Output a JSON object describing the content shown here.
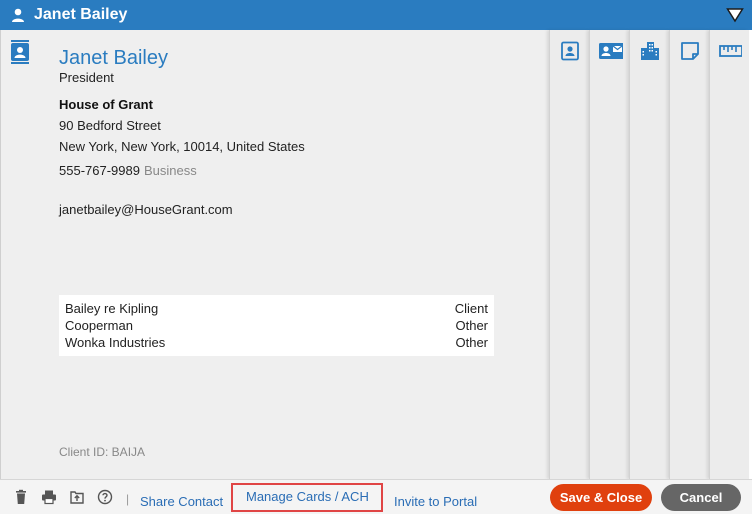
{
  "window": {
    "title": "Janet Bailey"
  },
  "contact": {
    "name": "Janet Bailey",
    "job_title": "President",
    "company": "House of Grant",
    "address_line1": "90 Bedford Street",
    "address_line2": "New York, New York, 10014, United States",
    "phone": "555-767-9989",
    "phone_type": "Business",
    "email": "janetbailey@HouseGrant.com",
    "client_id": "Client ID: BAIJA"
  },
  "relations": [
    {
      "name": "Bailey re Kipling",
      "type": "Client"
    },
    {
      "name": "Cooperman",
      "type": "Other"
    },
    {
      "name": "Wonka Industries",
      "type": "Other"
    }
  ],
  "tabs": [
    {
      "icon": "contact-card-icon"
    },
    {
      "icon": "contact-mail-icon"
    },
    {
      "icon": "building-icon"
    },
    {
      "icon": "note-icon"
    },
    {
      "icon": "ruler-icon"
    }
  ],
  "footer": {
    "icons": [
      "trash-icon",
      "print-icon",
      "export-icon",
      "help-icon"
    ],
    "separator": "|",
    "share_contact": "Share Contact",
    "manage_cards": "Manage Cards / ACH",
    "invite_portal": "Invite to Portal",
    "save_close": "Save & Close",
    "cancel": "Cancel"
  },
  "colors": {
    "accent": "#2a7cc0",
    "save": "#e0400e",
    "cancel": "#666666",
    "highlight": "#e04545"
  }
}
